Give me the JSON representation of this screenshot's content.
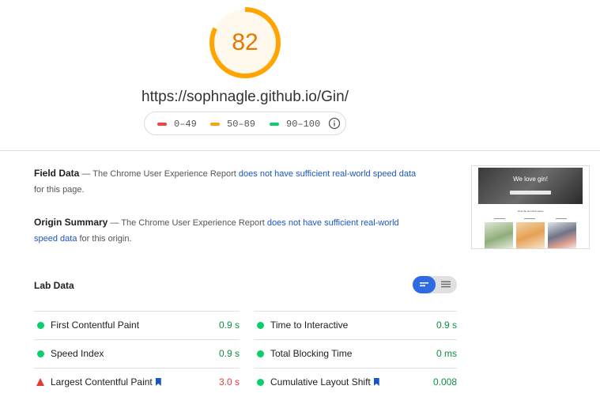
{
  "score": "82",
  "url": "https://sophnagle.github.io/Gin/",
  "legend": [
    {
      "range": "0–49",
      "color": "#f4433b"
    },
    {
      "range": "50–89",
      "color": "#ffa400"
    },
    {
      "range": "90–100",
      "color": "#0cce6b"
    }
  ],
  "colors": {
    "average": "#ffa400",
    "pass": "#0a8f43",
    "fail": "#e53935",
    "link": "#1a55c8"
  },
  "field_data": {
    "title": "Field Data",
    "prefix": "— The Chrome User Experience Report",
    "link": "does not have sufficient real-world speed data",
    "suffix": "for this page."
  },
  "origin_summary": {
    "title": "Origin Summary",
    "prefix": "— The Chrome User Experience Report",
    "link": "does not have sufficient real-world speed data",
    "suffix": "for this origin."
  },
  "thumbnail": {
    "heading": "We love gin!",
    "subheading": "View the Gin Club series"
  },
  "lab_data": {
    "title": "Lab Data",
    "metrics_left": [
      {
        "name": "First Contentful Paint",
        "value": "0.9 s",
        "status": "pass"
      },
      {
        "name": "Speed Index",
        "value": "0.9 s",
        "status": "pass"
      },
      {
        "name": "Largest Contentful Paint",
        "value": "3.0 s",
        "status": "fail"
      }
    ],
    "metrics_right": [
      {
        "name": "Time to Interactive",
        "value": "0.9 s",
        "status": "pass"
      },
      {
        "name": "Total Blocking Time",
        "value": "0 ms",
        "status": "pass"
      },
      {
        "name": "Cumulative Layout Shift",
        "value": "0.008",
        "status": "pass"
      }
    ]
  }
}
